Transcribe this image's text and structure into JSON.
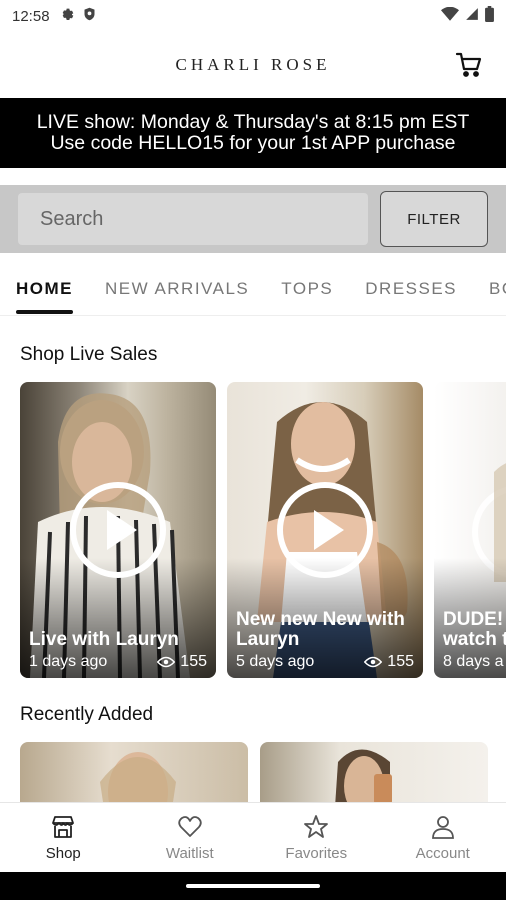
{
  "status_bar": {
    "time": "12:58"
  },
  "header": {
    "brand": "CHARLI ROSE"
  },
  "promo": {
    "line1": "LIVE show: Monday & Thursday's at 8:15 pm EST",
    "line2": "Use code HELLO15 for your 1st APP purchase"
  },
  "search": {
    "placeholder": "Search",
    "filter_label": "FILTER"
  },
  "tabs": [
    "HOME",
    "NEW ARRIVALS",
    "TOPS",
    "DRESSES",
    "BO"
  ],
  "sections": {
    "live": "Shop Live Sales",
    "recent": "Recently Added"
  },
  "live_sales": [
    {
      "title": "Live with Lauryn",
      "age": "1 days ago",
      "views": "155"
    },
    {
      "title": "New new New with Lauryn",
      "age": "5 days ago",
      "views": "155"
    },
    {
      "title": "DUDE! watch t",
      "age": "8 days a",
      "views": ""
    }
  ],
  "bottom_nav": {
    "shop": "Shop",
    "waitlist": "Waitlist",
    "favorites": "Favorites",
    "account": "Account"
  },
  "colors": {
    "promo_bg": "#000000",
    "search_bg": "#c7c7c7",
    "active_tab": "#111111"
  }
}
